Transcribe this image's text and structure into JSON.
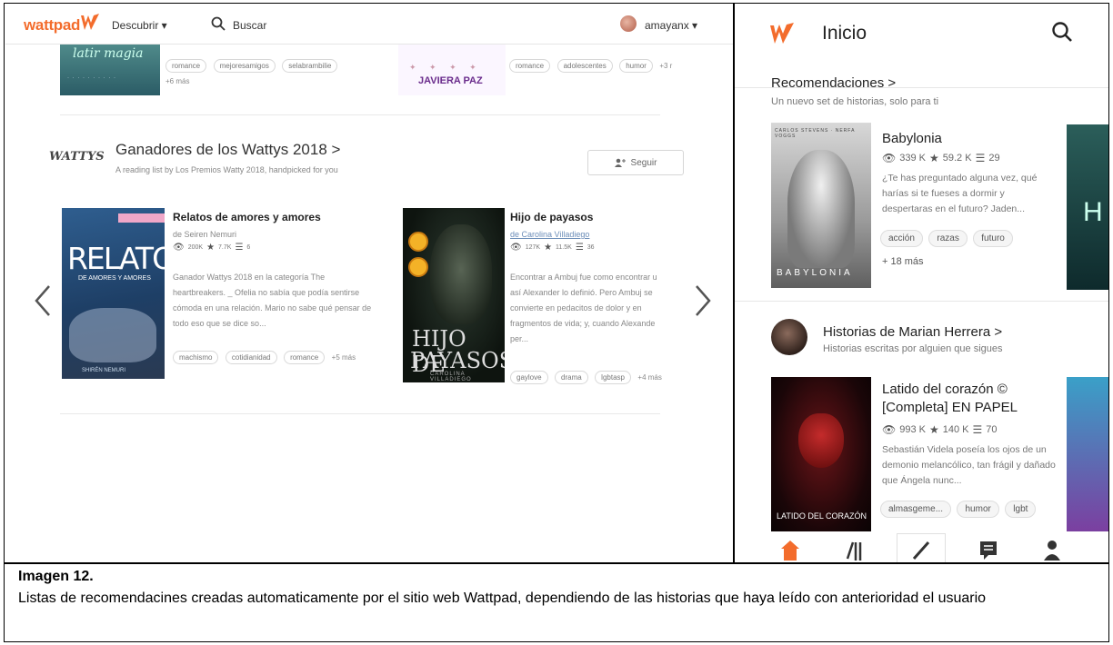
{
  "desktop": {
    "nav": {
      "logo": "wattpad",
      "descubrir": "Descubrir ▾",
      "search_label": "Buscar",
      "user": "amayanx ▾"
    },
    "prev_row": {
      "cover1_title": "latir magia",
      "tags1": [
        "romance",
        "mejoresamigos",
        "selabrambilie"
      ],
      "more1": "+6 más",
      "cover2_author": "JAVIERA PAZ",
      "tags2": [
        "romance",
        "adolescentes",
        "humor",
        "+3 r"
      ]
    },
    "list": {
      "logo": "WATTYS",
      "title": "Ganadores de los Wattys 2018 >",
      "subtitle": "A reading list by Los Premios Watty 2018, handpicked for you",
      "follow": "Seguir"
    },
    "book1": {
      "cover_big": "RELATOS",
      "cover_sub": "DE AMORES Y AMORES",
      "cover_author": "SHIRÉN NEMURI",
      "title": "Relatos de amores y amores",
      "author": "de Seiren Nemuri",
      "reads": "200K",
      "votes": "7.7K",
      "parts": "6",
      "description": "Ganador Wattys 2018 en la categoría The heartbreakers. _ Ofelia no sabía que podía sentirse cómoda en una relación. Mario no sabe qué pensar de todo eso que se dice so...",
      "tags": [
        "machismo",
        "cotidianidad",
        "romance"
      ],
      "more": "+5 más"
    },
    "book2": {
      "cover_line1": "HIJO DE",
      "cover_line2": "PAYASOS",
      "cover_author": "CAROLINA VILLADIEGO",
      "title": "Hijo de payasos",
      "author": "de Carolina Villadiego",
      "reads": "127K",
      "votes": "11.5K",
      "parts": "36",
      "description_lines": [
        "Encontrar a Ambuj fue como encontrar u",
        "así Alexander lo definió. Pero Ambuj se",
        "convierte en pedacitos de dolor y en",
        "fragmentos de vida; y, cuando Alexande",
        "per..."
      ],
      "tags": [
        "gaylove",
        "drama",
        "lgbtasp"
      ],
      "more": "+4 más"
    }
  },
  "mobile": {
    "header_title": "Inicio",
    "rec_title": "Recomendaciones >",
    "rec_subtitle": "Un nuevo set de historias, solo para ti",
    "book1": {
      "cover_top": "CARLOS STEVENS · NERFA VOGGS",
      "cover_name": "BABYLONIA",
      "title": "Babylonia",
      "reads": "339 K",
      "votes": "59.2 K",
      "parts": "29",
      "description": "¿Te has preguntado alguna vez, qué harías si te fueses a dormir y despertaras en el futuro? Jaden...",
      "tags": [
        "acción",
        "razas",
        "futuro"
      ],
      "more": "+ 18 más"
    },
    "section2_title": "Historias de Marian Herrera >",
    "section2_subtitle": "Historias escritas por alguien que sigues",
    "book2": {
      "cover_name": "LATIDO DEL CORAZÓN",
      "title": "Latido del corazón © [Completa] EN PAPEL",
      "reads": "993 K",
      "votes": "140 K",
      "parts": "70",
      "description": "Sebastián Videla poseía los ojos de un demonio melancólico, tan frágil y dañado que Ángela nunc...",
      "tags": [
        "almasgeme...",
        "humor",
        "lgbt"
      ]
    }
  },
  "caption": {
    "title": "Imagen 12.",
    "text": "Listas de recomendacines creadas automaticamente por el sitio web Wattpad, dependiendo de las historias que haya leído con anterioridad el usuario"
  },
  "colors": {
    "brand": "#f36c2c",
    "link": "#6b8db8"
  }
}
